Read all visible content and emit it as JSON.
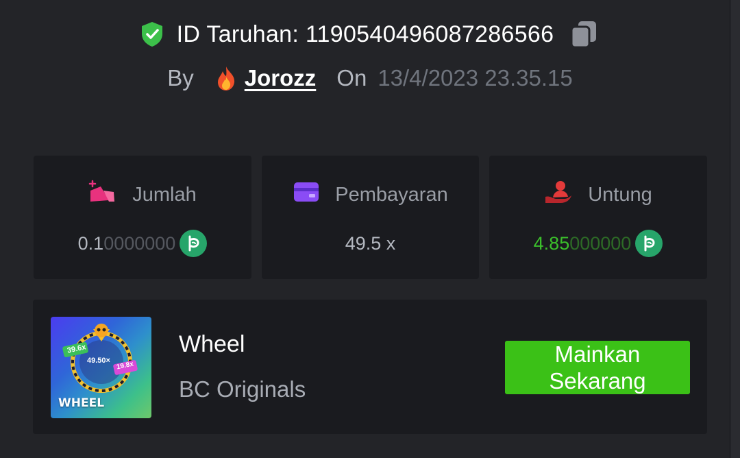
{
  "bet": {
    "id_label": "ID Taruhan: 1190540496087286566"
  },
  "meta": {
    "by_label": "By",
    "username": "Jorozz",
    "on_label": "On",
    "date": "13/4/2023 23.35.15"
  },
  "stats": {
    "amount": {
      "label": "Jumlah",
      "value_main": "0.1",
      "value_dim": "0000000"
    },
    "payout": {
      "label": "Pembayaran",
      "value": "49.5 x"
    },
    "profit": {
      "label": "Untung",
      "value_main": "4.85",
      "value_dim": "000000"
    }
  },
  "game": {
    "name": "Wheel",
    "provider": "BC Originals",
    "play_label": "Mainkan Sekarang",
    "thumb_title": "WHEEL",
    "thumb_mult_center": "49.50×",
    "thumb_mult_left": "39.6x",
    "thumb_mult_right": "19.8x"
  },
  "colors": {
    "background": "#232428",
    "card": "#1a1b1f",
    "accent_green": "#3bc117",
    "profit_green": "#3bbf2b",
    "coin_green": "#27a56a"
  },
  "icons": [
    "shield-check-icon",
    "copy-icon",
    "fire-icon",
    "coins-icon",
    "card-icon",
    "hand-user-icon",
    "bc-coin-icon"
  ]
}
